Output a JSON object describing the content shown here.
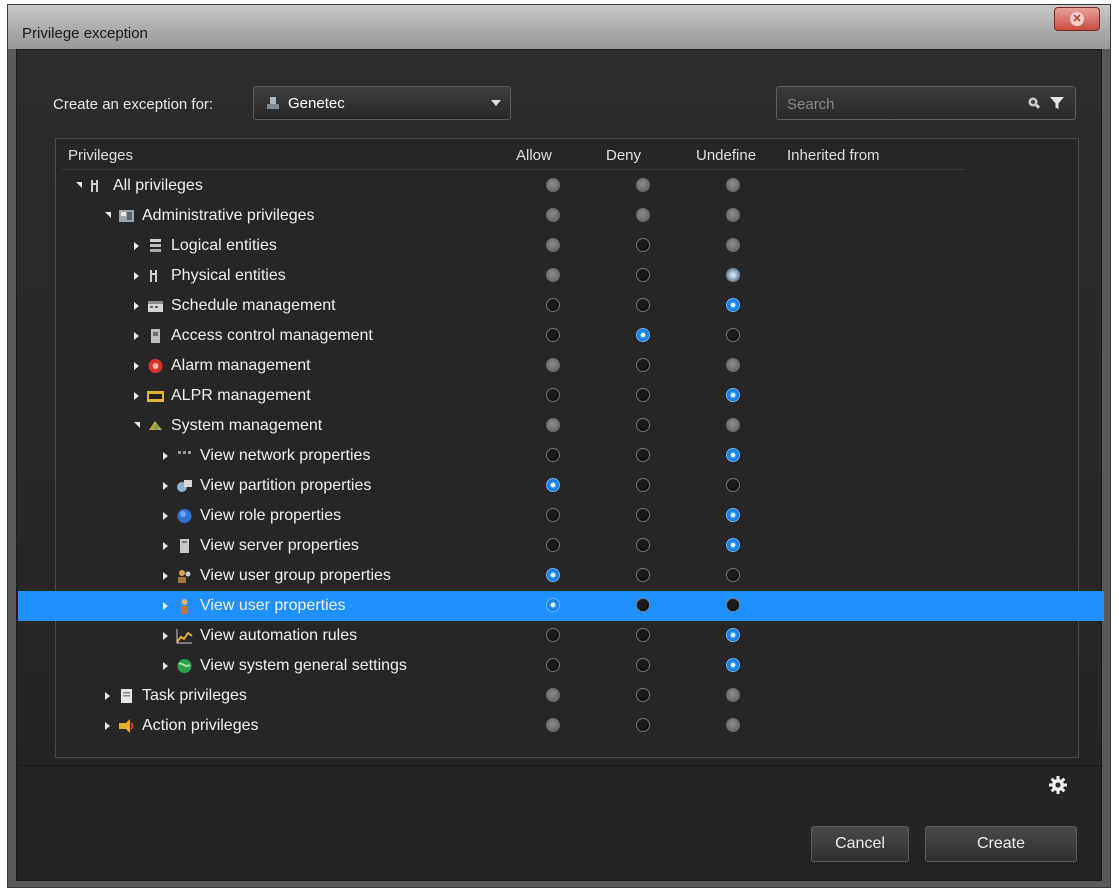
{
  "window": {
    "title": "Privilege exception"
  },
  "header": {
    "create_label": "Create an exception for:",
    "selected_entity": "Genetec",
    "search_placeholder": "Search"
  },
  "columns": {
    "privileges": "Privileges",
    "allow": "Allow",
    "deny": "Deny",
    "undefine": "Undefine",
    "inherited": "Inherited from"
  },
  "rows": [
    {
      "label": "All privileges",
      "icon": "privileges-icon",
      "allow": "dis",
      "deny": "dis",
      "undefine": "dis"
    },
    {
      "label": "Administrative privileges",
      "icon": "admin-icon",
      "allow": "dis",
      "deny": "dis",
      "undefine": "dis"
    },
    {
      "label": "Logical entities",
      "icon": "logical-entities-icon",
      "allow": "dis",
      "deny": "off",
      "undefine": "dis"
    },
    {
      "label": "Physical entities",
      "icon": "physical-entities-icon",
      "allow": "dis",
      "deny": "off",
      "undefine": "dison"
    },
    {
      "label": "Schedule management",
      "icon": "schedule-icon",
      "allow": "off",
      "deny": "off",
      "undefine": "on"
    },
    {
      "label": "Access control management",
      "icon": "access-control-icon",
      "allow": "off",
      "deny": "on",
      "undefine": "off"
    },
    {
      "label": "Alarm management",
      "icon": "alarm-icon",
      "allow": "dis",
      "deny": "off",
      "undefine": "dis"
    },
    {
      "label": "ALPR management",
      "icon": "alpr-icon",
      "allow": "off",
      "deny": "off",
      "undefine": "on"
    },
    {
      "label": "System management",
      "icon": "system-icon",
      "allow": "dis",
      "deny": "off",
      "undefine": "dis"
    },
    {
      "label": "View network properties",
      "icon": "network-icon",
      "allow": "off",
      "deny": "off",
      "undefine": "on"
    },
    {
      "label": "View partition properties",
      "icon": "partition-icon",
      "allow": "on",
      "deny": "off",
      "undefine": "off"
    },
    {
      "label": "View role properties",
      "icon": "role-icon",
      "allow": "off",
      "deny": "off",
      "undefine": "on"
    },
    {
      "label": "View server properties",
      "icon": "server-icon",
      "allow": "off",
      "deny": "off",
      "undefine": "on"
    },
    {
      "label": "View user group properties",
      "icon": "user-group-icon",
      "allow": "on",
      "deny": "off",
      "undefine": "off"
    },
    {
      "label": "View user properties",
      "icon": "user-icon",
      "allow": "on",
      "deny": "off",
      "undefine": "off"
    },
    {
      "label": "View automation rules",
      "icon": "automation-icon",
      "allow": "off",
      "deny": "off",
      "undefine": "on"
    },
    {
      "label": "View system general settings",
      "icon": "settings-globe-icon",
      "allow": "off",
      "deny": "off",
      "undefine": "on"
    },
    {
      "label": "Task privileges",
      "icon": "task-icon",
      "allow": "dis",
      "deny": "off",
      "undefine": "dis"
    },
    {
      "label": "Action privileges",
      "icon": "action-icon",
      "allow": "dis",
      "deny": "off",
      "undefine": "dis"
    }
  ],
  "footer": {
    "cancel_label": "Cancel",
    "create_label": "Create"
  },
  "colors": {
    "selection": "#1e90ff",
    "background": "#262626"
  }
}
